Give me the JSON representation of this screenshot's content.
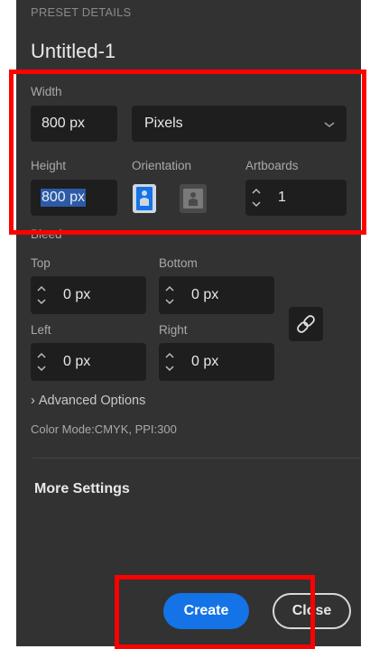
{
  "preset": {
    "section_label": "PRESET DETAILS",
    "name": "Untitled-1"
  },
  "width": {
    "label": "Width",
    "value": "800 px",
    "unit": "Pixels"
  },
  "height": {
    "label": "Height",
    "value": "800 px"
  },
  "orientation": {
    "label": "Orientation",
    "selected": "portrait"
  },
  "artboards": {
    "label": "Artboards",
    "value": "1"
  },
  "bleed": {
    "label": "Bleed",
    "top": {
      "label": "Top",
      "value": "0 px"
    },
    "bottom": {
      "label": "Bottom",
      "value": "0 px"
    },
    "left": {
      "label": "Left",
      "value": "0 px"
    },
    "right": {
      "label": "Right",
      "value": "0 px"
    }
  },
  "advanced": {
    "label": "Advanced Options",
    "chevron": "›"
  },
  "color_mode": "Color Mode:CMYK, PPI:300",
  "more_settings": "More Settings",
  "buttons": {
    "create": "Create",
    "close": "Close"
  },
  "colors": {
    "panel": "#323232",
    "field": "#1e1e1e",
    "accent": "#1473e6",
    "annotation": "#ff0000"
  }
}
